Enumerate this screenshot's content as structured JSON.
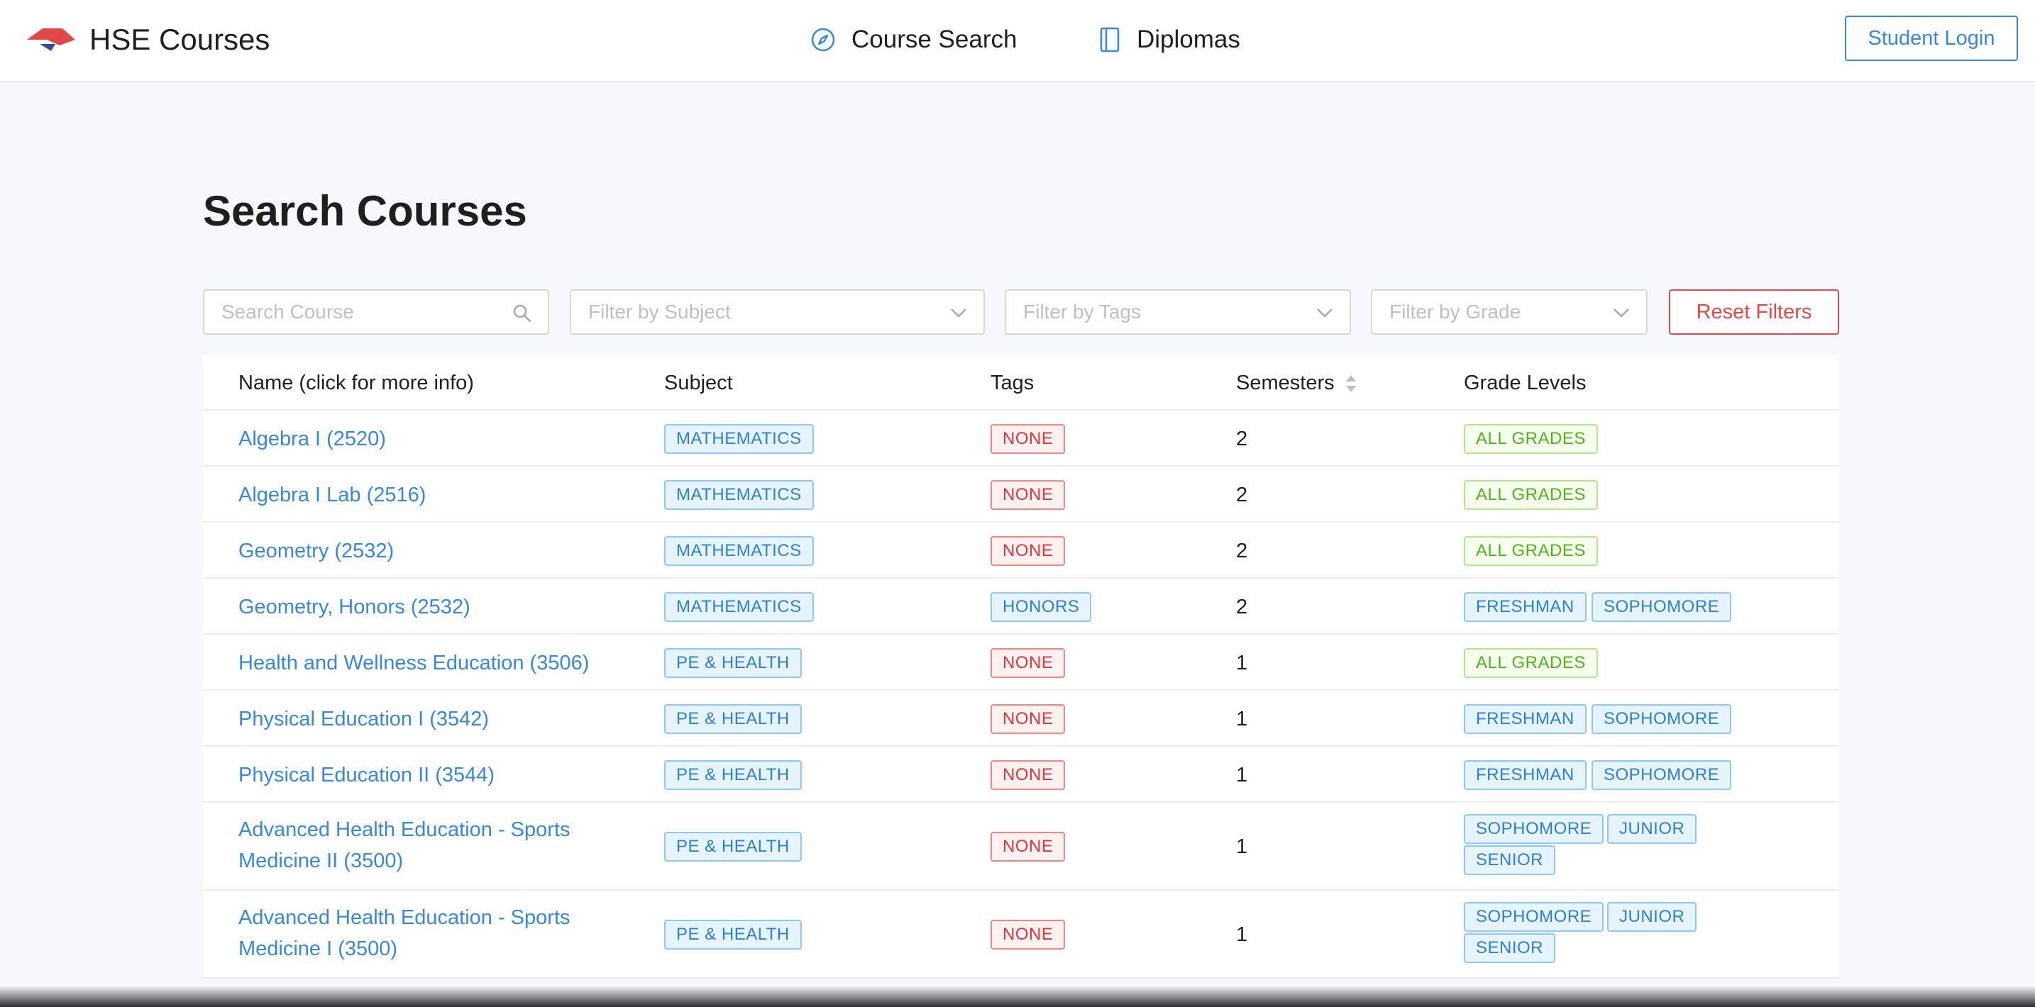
{
  "app": {
    "brand": "HSE Courses",
    "login_label": "Student Login"
  },
  "nav": {
    "course_search": "Course Search",
    "diplomas": "Diplomas"
  },
  "page": {
    "title": "Search Courses"
  },
  "filters": {
    "search_placeholder": "Search Course",
    "subject_placeholder": "Filter by Subject",
    "tags_placeholder": "Filter by Tags",
    "grade_placeholder": "Filter by Grade",
    "reset_label": "Reset Filters"
  },
  "table": {
    "headers": {
      "name": "Name (click for more info)",
      "subject": "Subject",
      "tags": "Tags",
      "semesters": "Semesters",
      "grades": "Grade Levels"
    },
    "rows": [
      {
        "name": "Algebra I (2520)",
        "subject": "MATHEMATICS",
        "tag": "NONE",
        "semesters": "2",
        "grades": [
          "ALL GRADES"
        ]
      },
      {
        "name": "Algebra I Lab (2516)",
        "subject": "MATHEMATICS",
        "tag": "NONE",
        "semesters": "2",
        "grades": [
          "ALL GRADES"
        ]
      },
      {
        "name": "Geometry (2532)",
        "subject": "MATHEMATICS",
        "tag": "NONE",
        "semesters": "2",
        "grades": [
          "ALL GRADES"
        ]
      },
      {
        "name": "Geometry, Honors (2532)",
        "subject": "MATHEMATICS",
        "tag": "HONORS",
        "semesters": "2",
        "grades": [
          "FRESHMAN",
          "SOPHOMORE"
        ]
      },
      {
        "name": "Health and Wellness Education (3506)",
        "subject": "PE & HEALTH",
        "tag": "NONE",
        "semesters": "1",
        "grades": [
          "ALL GRADES"
        ]
      },
      {
        "name": "Physical Education I (3542)",
        "subject": "PE & HEALTH",
        "tag": "NONE",
        "semesters": "1",
        "grades": [
          "FRESHMAN",
          "SOPHOMORE"
        ]
      },
      {
        "name": "Physical Education II (3544)",
        "subject": "PE & HEALTH",
        "tag": "NONE",
        "semesters": "1",
        "grades": [
          "FRESHMAN",
          "SOPHOMORE"
        ]
      },
      {
        "name": "Advanced Health Education - Sports Medicine II (3500)",
        "subject": "PE & HEALTH",
        "tag": "NONE",
        "semesters": "1",
        "grades": [
          "SOPHOMORE",
          "JUNIOR",
          "SENIOR"
        ]
      },
      {
        "name": "Advanced Health Education - Sports Medicine I (3500)",
        "subject": "PE & HEALTH",
        "tag": "NONE",
        "semesters": "1",
        "grades": [
          "SOPHOMORE",
          "JUNIOR",
          "SENIOR"
        ]
      }
    ]
  },
  "colors": {
    "link": "#3a87d9",
    "danger": "#e0484a",
    "tag_blue": "#2f7fd1",
    "tag_red": "#d9363e",
    "tag_green": "#52b11b"
  },
  "icons": {
    "logo": "hse-logo",
    "course_search": "compass-icon",
    "diplomas": "book-icon",
    "search": "search-icon",
    "dropdown": "chevron-down-icon",
    "sort": "sort-icon"
  }
}
